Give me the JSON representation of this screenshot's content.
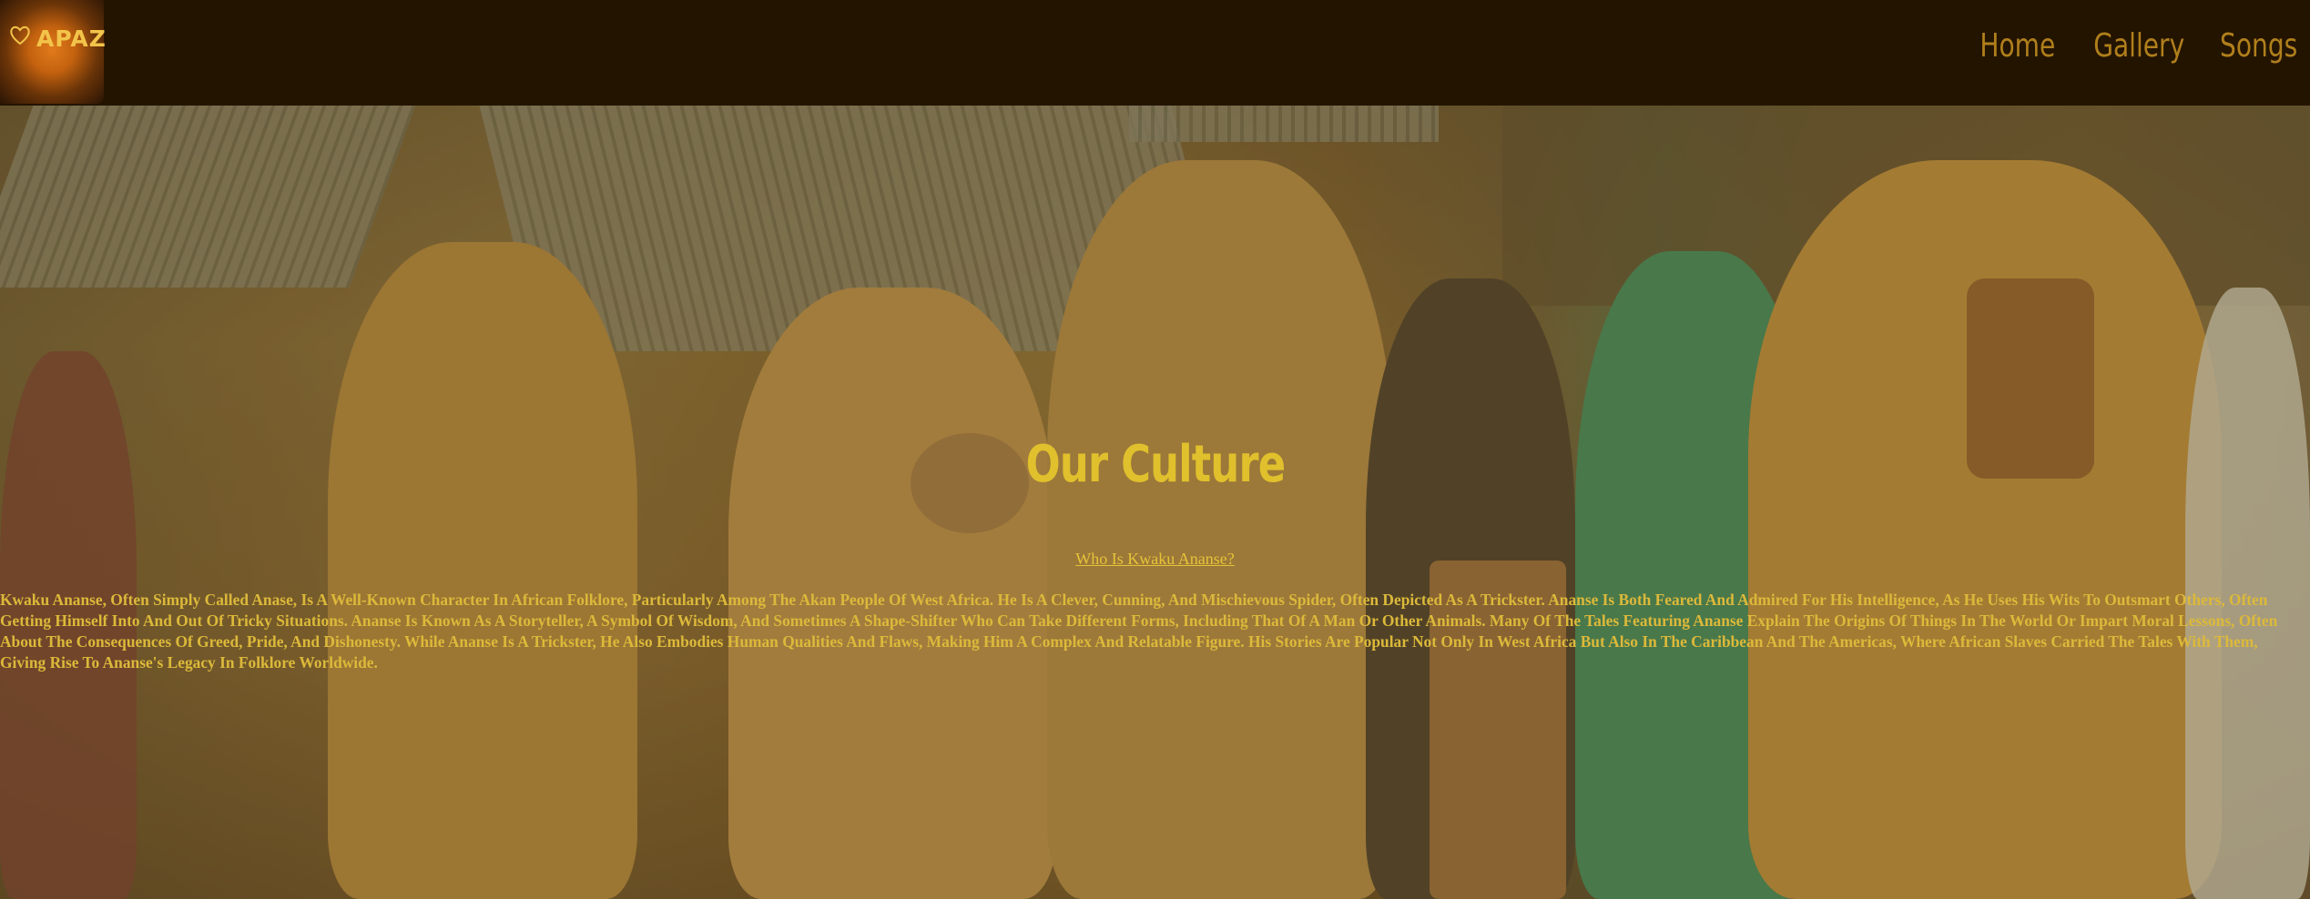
{
  "header": {
    "logo_text": "APAZ",
    "nav": [
      {
        "label": "Home"
      },
      {
        "label": "Gallery"
      },
      {
        "label": "Songs"
      }
    ]
  },
  "hero": {
    "title": "Our Culture",
    "link_label": "Who Is Kwaku Ananse?",
    "paragraph": "Kwaku Ananse, Often Simply Called Anase, Is A Well-Known Character In African Folklore, Particularly Among The Akan People Of West Africa. He Is A Clever, Cunning, And Mischievous Spider, Often Depicted As A Trickster. Ananse Is Both Feared And Admired For His Intelligence, As He Uses His Wits To Outsmart Others, Often Getting Himself Into And Out Of Tricky Situations. Ananse Is Known As A Storyteller, A Symbol Of Wisdom, And Sometimes A Shape-Shifter Who Can Take Different Forms, Including That Of A Man Or Other Animals. Many Of The Tales Featuring Ananse Explain The Origins Of Things In The World Or Impart Moral Lessons, Often About The Consequences Of Greed, Pride, And Dishonesty. While Ananse Is A Trickster, He Also Embodies Human Qualities And Flaws, Making Him A Complex And Relatable Figure. His Stories Are Popular Not Only In West Africa But Also In The Caribbean And The Americas, Where African Slaves Carried The Tales With Them, Giving Rise To Ananse's Legacy In Folklore Worldwide."
  },
  "colors": {
    "header_bg": "#231400",
    "nav_text": "#b07f1c",
    "title": "#e0c02c",
    "body_text": "#dcb93a"
  }
}
